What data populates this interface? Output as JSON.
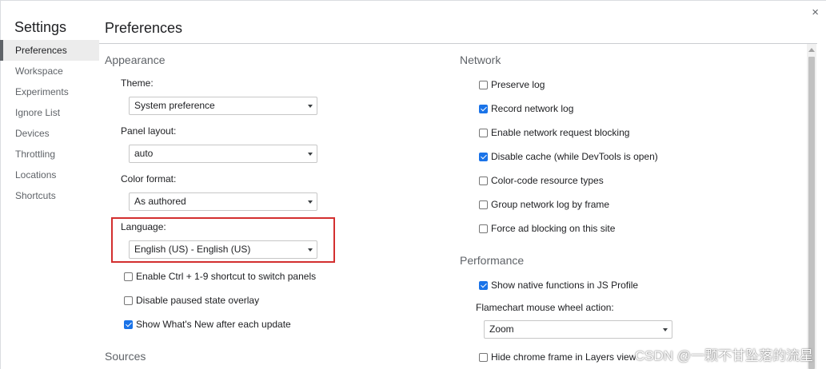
{
  "sidebar": {
    "title": "Settings",
    "items": [
      {
        "label": "Preferences",
        "selected": true
      },
      {
        "label": "Workspace"
      },
      {
        "label": "Experiments"
      },
      {
        "label": "Ignore List"
      },
      {
        "label": "Devices"
      },
      {
        "label": "Throttling"
      },
      {
        "label": "Locations"
      },
      {
        "label": "Shortcuts"
      }
    ]
  },
  "header": {
    "title": "Preferences",
    "close_icon": "×"
  },
  "appearance": {
    "title": "Appearance",
    "theme": {
      "label": "Theme:",
      "value": "System preference"
    },
    "panel_layout": {
      "label": "Panel layout:",
      "value": "auto"
    },
    "color_format": {
      "label": "Color format:",
      "value": "As authored"
    },
    "language": {
      "label": "Language:",
      "value": "English (US) - English (US)"
    },
    "checkboxes": [
      {
        "label": "Enable Ctrl + 1-9 shortcut to switch panels",
        "checked": false
      },
      {
        "label": "Disable paused state overlay",
        "checked": false
      },
      {
        "label": "Show What's New after each update",
        "checked": true
      }
    ]
  },
  "sources": {
    "title": "Sources"
  },
  "network": {
    "title": "Network",
    "checkboxes": [
      {
        "label": "Preserve log",
        "checked": false
      },
      {
        "label": "Record network log",
        "checked": true
      },
      {
        "label": "Enable network request blocking",
        "checked": false
      },
      {
        "label": "Disable cache (while DevTools is open)",
        "checked": true
      },
      {
        "label": "Color-code resource types",
        "checked": false
      },
      {
        "label": "Group network log by frame",
        "checked": false
      },
      {
        "label": "Force ad blocking on this site",
        "checked": false
      }
    ]
  },
  "performance": {
    "title": "Performance",
    "show_native": {
      "label": "Show native functions in JS Profile",
      "checked": true
    },
    "flamechart": {
      "label": "Flamechart mouse wheel action:",
      "value": "Zoom"
    },
    "hide_chrome": {
      "label": "Hide chrome frame in Layers view",
      "checked": false
    }
  },
  "colors": {
    "accent": "#1a73e8",
    "highlight": "#d32f2f"
  },
  "watermark": "CSDN @一颗不甘坠落的流星"
}
